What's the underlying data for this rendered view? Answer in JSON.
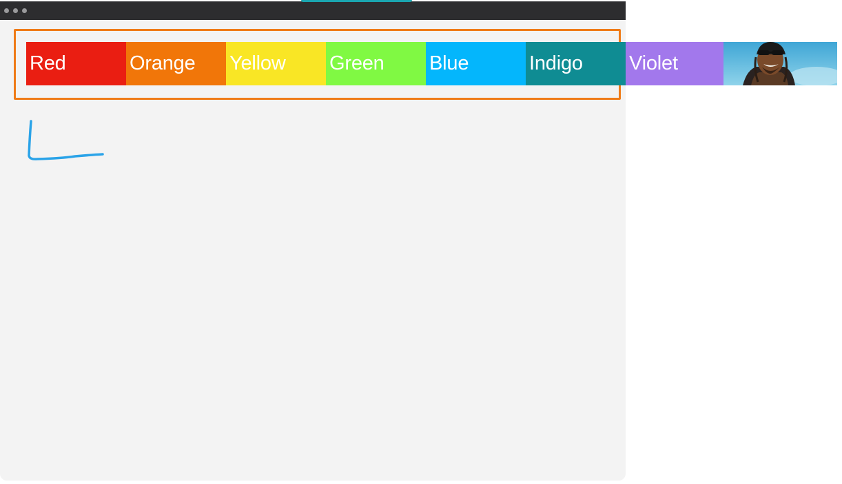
{
  "window": {
    "controls": [
      "close",
      "minimize",
      "zoom"
    ]
  },
  "swatches": [
    {
      "label": "Red",
      "color": "#ea1e12"
    },
    {
      "label": "Orange",
      "color": "#f17609"
    },
    {
      "label": "Yellow",
      "color": "#f9e625"
    },
    {
      "label": "Green",
      "color": "#80f943"
    },
    {
      "label": "Blue",
      "color": "#04b6fc"
    },
    {
      "label": "Indigo",
      "color": "#0f8c93"
    },
    {
      "label": "Violet",
      "color": "#a278ec"
    }
  ],
  "highlight_color": "#ef7b17",
  "annotation_color": "#2aa3e8"
}
